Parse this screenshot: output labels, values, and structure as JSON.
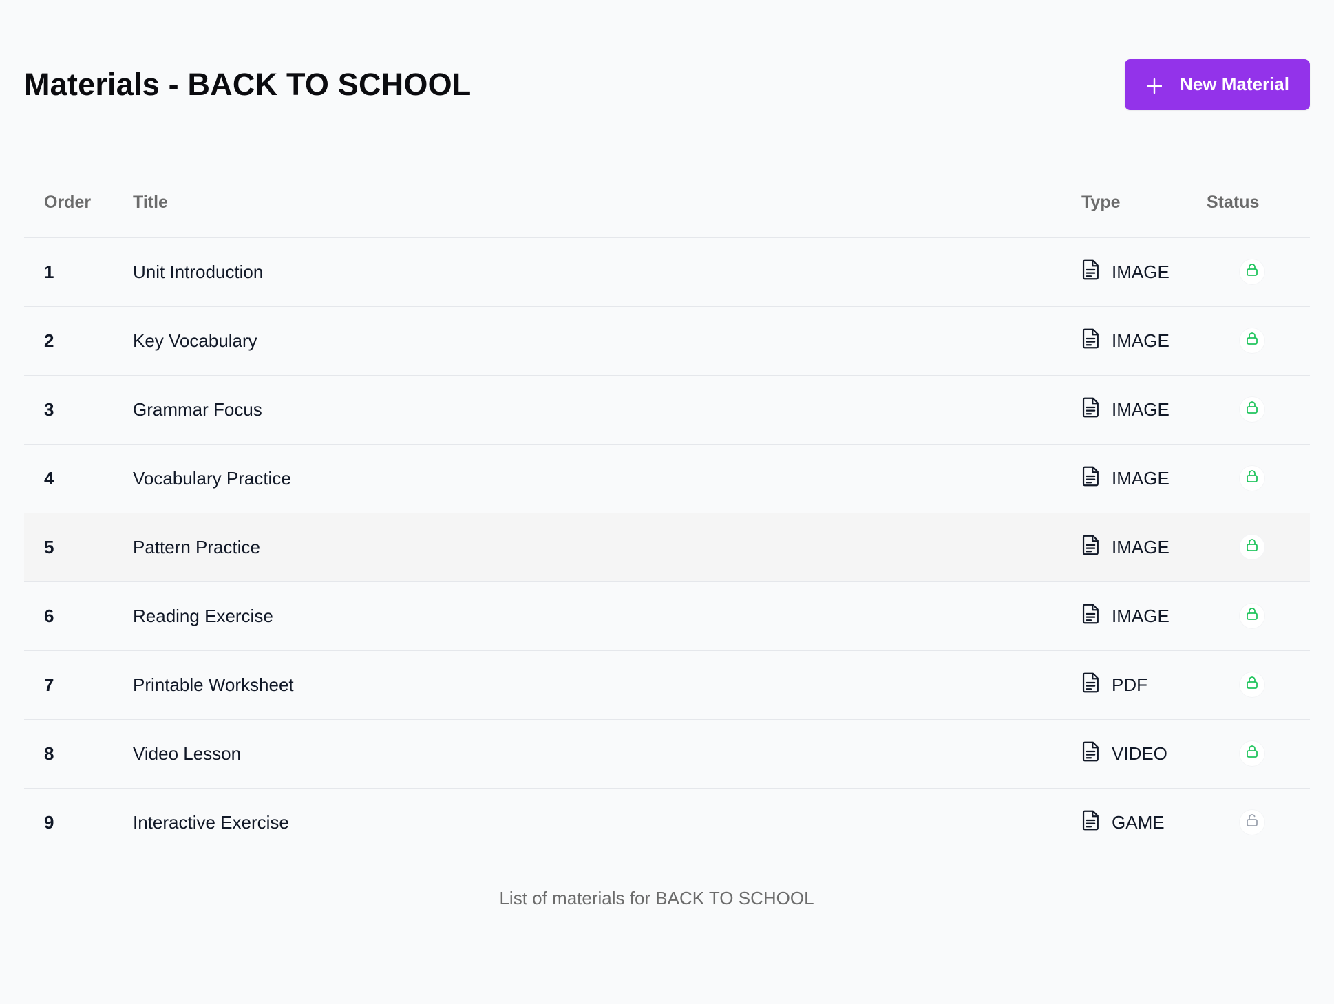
{
  "header": {
    "title": "Materials - BACK TO SCHOOL",
    "new_button_label": "New Material"
  },
  "table": {
    "columns": {
      "order": "Order",
      "title": "Title",
      "type": "Type",
      "status": "Status"
    },
    "rows": [
      {
        "order": "1",
        "title": "Unit Introduction",
        "type": "IMAGE",
        "status": "locked"
      },
      {
        "order": "2",
        "title": "Key Vocabulary",
        "type": "IMAGE",
        "status": "locked"
      },
      {
        "order": "3",
        "title": "Grammar Focus",
        "type": "IMAGE",
        "status": "locked"
      },
      {
        "order": "4",
        "title": "Vocabulary Practice",
        "type": "IMAGE",
        "status": "locked"
      },
      {
        "order": "5",
        "title": "Pattern Practice",
        "type": "IMAGE",
        "status": "locked"
      },
      {
        "order": "6",
        "title": "Reading Exercise",
        "type": "IMAGE",
        "status": "locked"
      },
      {
        "order": "7",
        "title": "Printable Worksheet",
        "type": "PDF",
        "status": "locked"
      },
      {
        "order": "8",
        "title": "Video Lesson",
        "type": "VIDEO",
        "status": "locked"
      },
      {
        "order": "9",
        "title": "Interactive Exercise",
        "type": "GAME",
        "status": "unlocked"
      }
    ],
    "caption": "List of materials for BACK TO SCHOOL"
  },
  "colors": {
    "accent": "#9333ea",
    "locked": "#22c55e",
    "unlocked": "#9ca3af"
  },
  "icons": {
    "add": "plus-icon",
    "type": "document-icon",
    "locked": "lock-icon",
    "unlocked": "unlock-icon"
  }
}
